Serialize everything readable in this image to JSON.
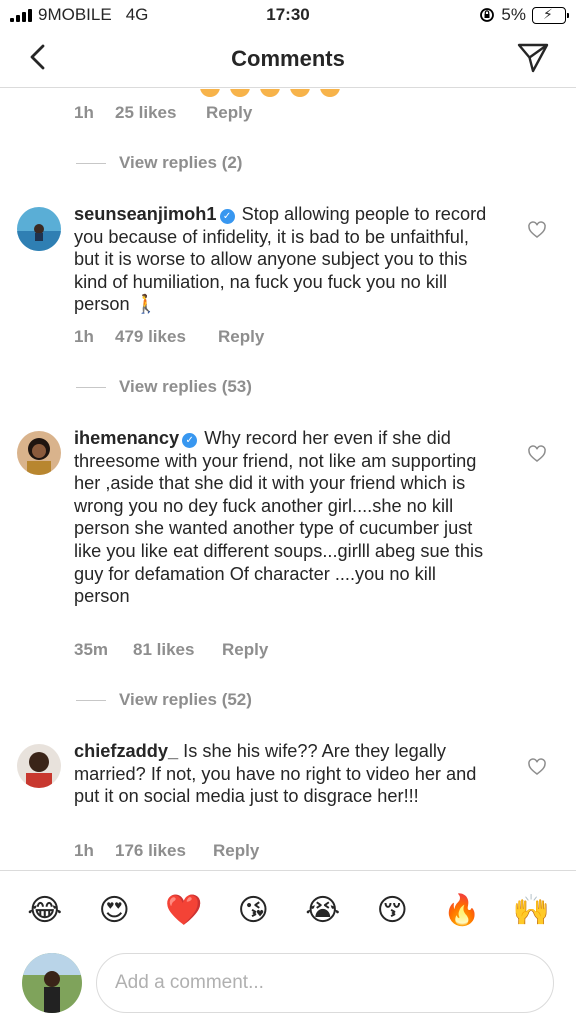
{
  "status_bar": {
    "carrier": "9MOBILE",
    "network": "4G",
    "time": "17:30",
    "battery": "5%"
  },
  "header": {
    "title": "Comments"
  },
  "top_partial": {
    "time": "1h",
    "likes": "25 likes",
    "reply": "Reply",
    "view_replies": "View replies (2)"
  },
  "comments": [
    {
      "username": "seunseanjimoh1",
      "text": "Stop allowing people to record you because of infidelity, it is bad to be unfaithful,  but it is worse to allow anyone subject you to this kind of humiliation,  na fuck you fuck you no kill person 🚶",
      "time": "1h",
      "likes": "479 likes",
      "reply": "Reply",
      "view_replies": "View replies (53)"
    },
    {
      "username": "ihemenancy",
      "text": "Why record her even if she did threesome with your friend, not like am supporting her ,aside that she did it with your friend which is wrong you no dey fuck another girl....she no kill person she wanted another type of cucumber just like you like eat different soups...girlll abeg sue this guy for defamation Of character ....you no kill person",
      "time": "35m",
      "likes": "81 likes",
      "reply": "Reply",
      "view_replies": "View replies (52)"
    },
    {
      "username": "chiefzaddy_",
      "text": "Is she his wife?? Are they legally married?  If not, you have no right to video her and put it on social media just to disgrace her!!!",
      "time": "1h",
      "likes": "176 likes",
      "reply": "Reply"
    }
  ],
  "emoji_bar": [
    "😂",
    "😍",
    "❤️",
    "😘",
    "😭",
    "😚",
    "🔥",
    "🙌"
  ],
  "input": {
    "placeholder": "Add a comment..."
  }
}
